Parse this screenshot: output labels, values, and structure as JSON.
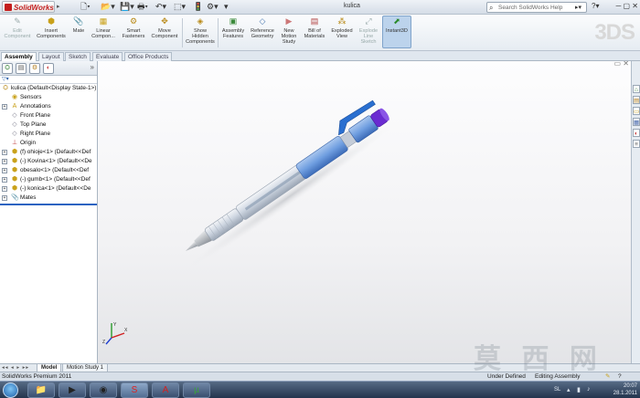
{
  "app": {
    "logo_text": "SolidWorks",
    "window_title": "kulica",
    "search_placeholder": "Search SolidWorks Help",
    "quick_access_icons": [
      "new-icon",
      "open-icon",
      "save-icon",
      "print-icon",
      "undo-icon",
      "select-icon",
      "rebuild-icon",
      "options-icon"
    ]
  },
  "command_manager": {
    "tools": [
      {
        "label": "Edit\nComponent",
        "icon": "edit-component-icon",
        "disabled": true
      },
      {
        "label": "Insert\nComponents",
        "icon": "insert-components-icon"
      },
      {
        "label": "Mate",
        "icon": "mate-icon"
      },
      {
        "label": "Linear\nCompon...",
        "icon": "linear-pattern-icon"
      },
      {
        "label": "Smart\nFasteners",
        "icon": "smart-fasteners-icon"
      },
      {
        "label": "Move\nComponent",
        "icon": "move-component-icon"
      },
      {
        "label": "Show\nHidden\nComponents",
        "icon": "show-hidden-icon"
      },
      {
        "label": "Assembly\nFeatures",
        "icon": "assembly-features-icon"
      },
      {
        "label": "Reference\nGeometry",
        "icon": "reference-geometry-icon"
      },
      {
        "label": "New\nMotion\nStudy",
        "icon": "motion-study-icon"
      },
      {
        "label": "Bill of\nMaterials",
        "icon": "bom-icon"
      },
      {
        "label": "Exploded\nView",
        "icon": "exploded-view-icon"
      },
      {
        "label": "Explode\nLine\nSketch",
        "icon": "explode-line-icon",
        "disabled": true
      },
      {
        "label": "Instant3D",
        "icon": "instant3d-icon",
        "active": true
      }
    ]
  },
  "tabs": [
    "Assembly",
    "Layout",
    "Sketch",
    "Evaluate",
    "Office Products"
  ],
  "active_tab": "Assembly",
  "feature_tree": {
    "root": "kulica  (Default<Display State-1>)",
    "items": [
      {
        "label": "Sensors",
        "icon": "sensors-icon",
        "expand": false
      },
      {
        "label": "Annotations",
        "icon": "annotations-icon",
        "expand": true
      },
      {
        "label": "Front Plane",
        "icon": "plane-icon",
        "expand": false
      },
      {
        "label": "Top Plane",
        "icon": "plane-icon",
        "expand": false
      },
      {
        "label": "Right Plane",
        "icon": "plane-icon",
        "expand": false
      },
      {
        "label": "Origin",
        "icon": "origin-icon",
        "expand": false
      },
      {
        "label": "(f) ohioje<1> (Default<<Def",
        "icon": "part-icon",
        "expand": true
      },
      {
        "label": "(-) Kovina<1> (Default<<De",
        "icon": "part-icon",
        "expand": true
      },
      {
        "label": "obesalo<1> (Default<<Def",
        "icon": "part-icon",
        "expand": true
      },
      {
        "label": "(-) gumb<1> (Default<<Def",
        "icon": "part-icon",
        "expand": true
      },
      {
        "label": "(-) konica<1> (Default<<De",
        "icon": "part-icon",
        "expand": true
      },
      {
        "label": "Mates",
        "icon": "mates-icon",
        "expand": true
      }
    ]
  },
  "bottom_tabs": [
    "Model",
    "Motion Study 1"
  ],
  "active_bottom_tab": "Model",
  "status": {
    "product": "SolidWorks Premium 2011",
    "define": "Under Defined",
    "mode": "Editing Assembly"
  },
  "taskbar": {
    "apps": [
      "explorer",
      "media-player",
      "chrome",
      "solidworks",
      "acrobat",
      "utorrent"
    ],
    "active_app": "solidworks",
    "language": "SL",
    "time": "20:07",
    "date": "28.1.2011"
  },
  "watermark": "莫 西 网",
  "colors": {
    "accent": "#2a63c1",
    "pencil_body": "#b8c8dc",
    "pencil_clip": "#2a6fd0",
    "pencil_button": "#6a2bd1"
  }
}
